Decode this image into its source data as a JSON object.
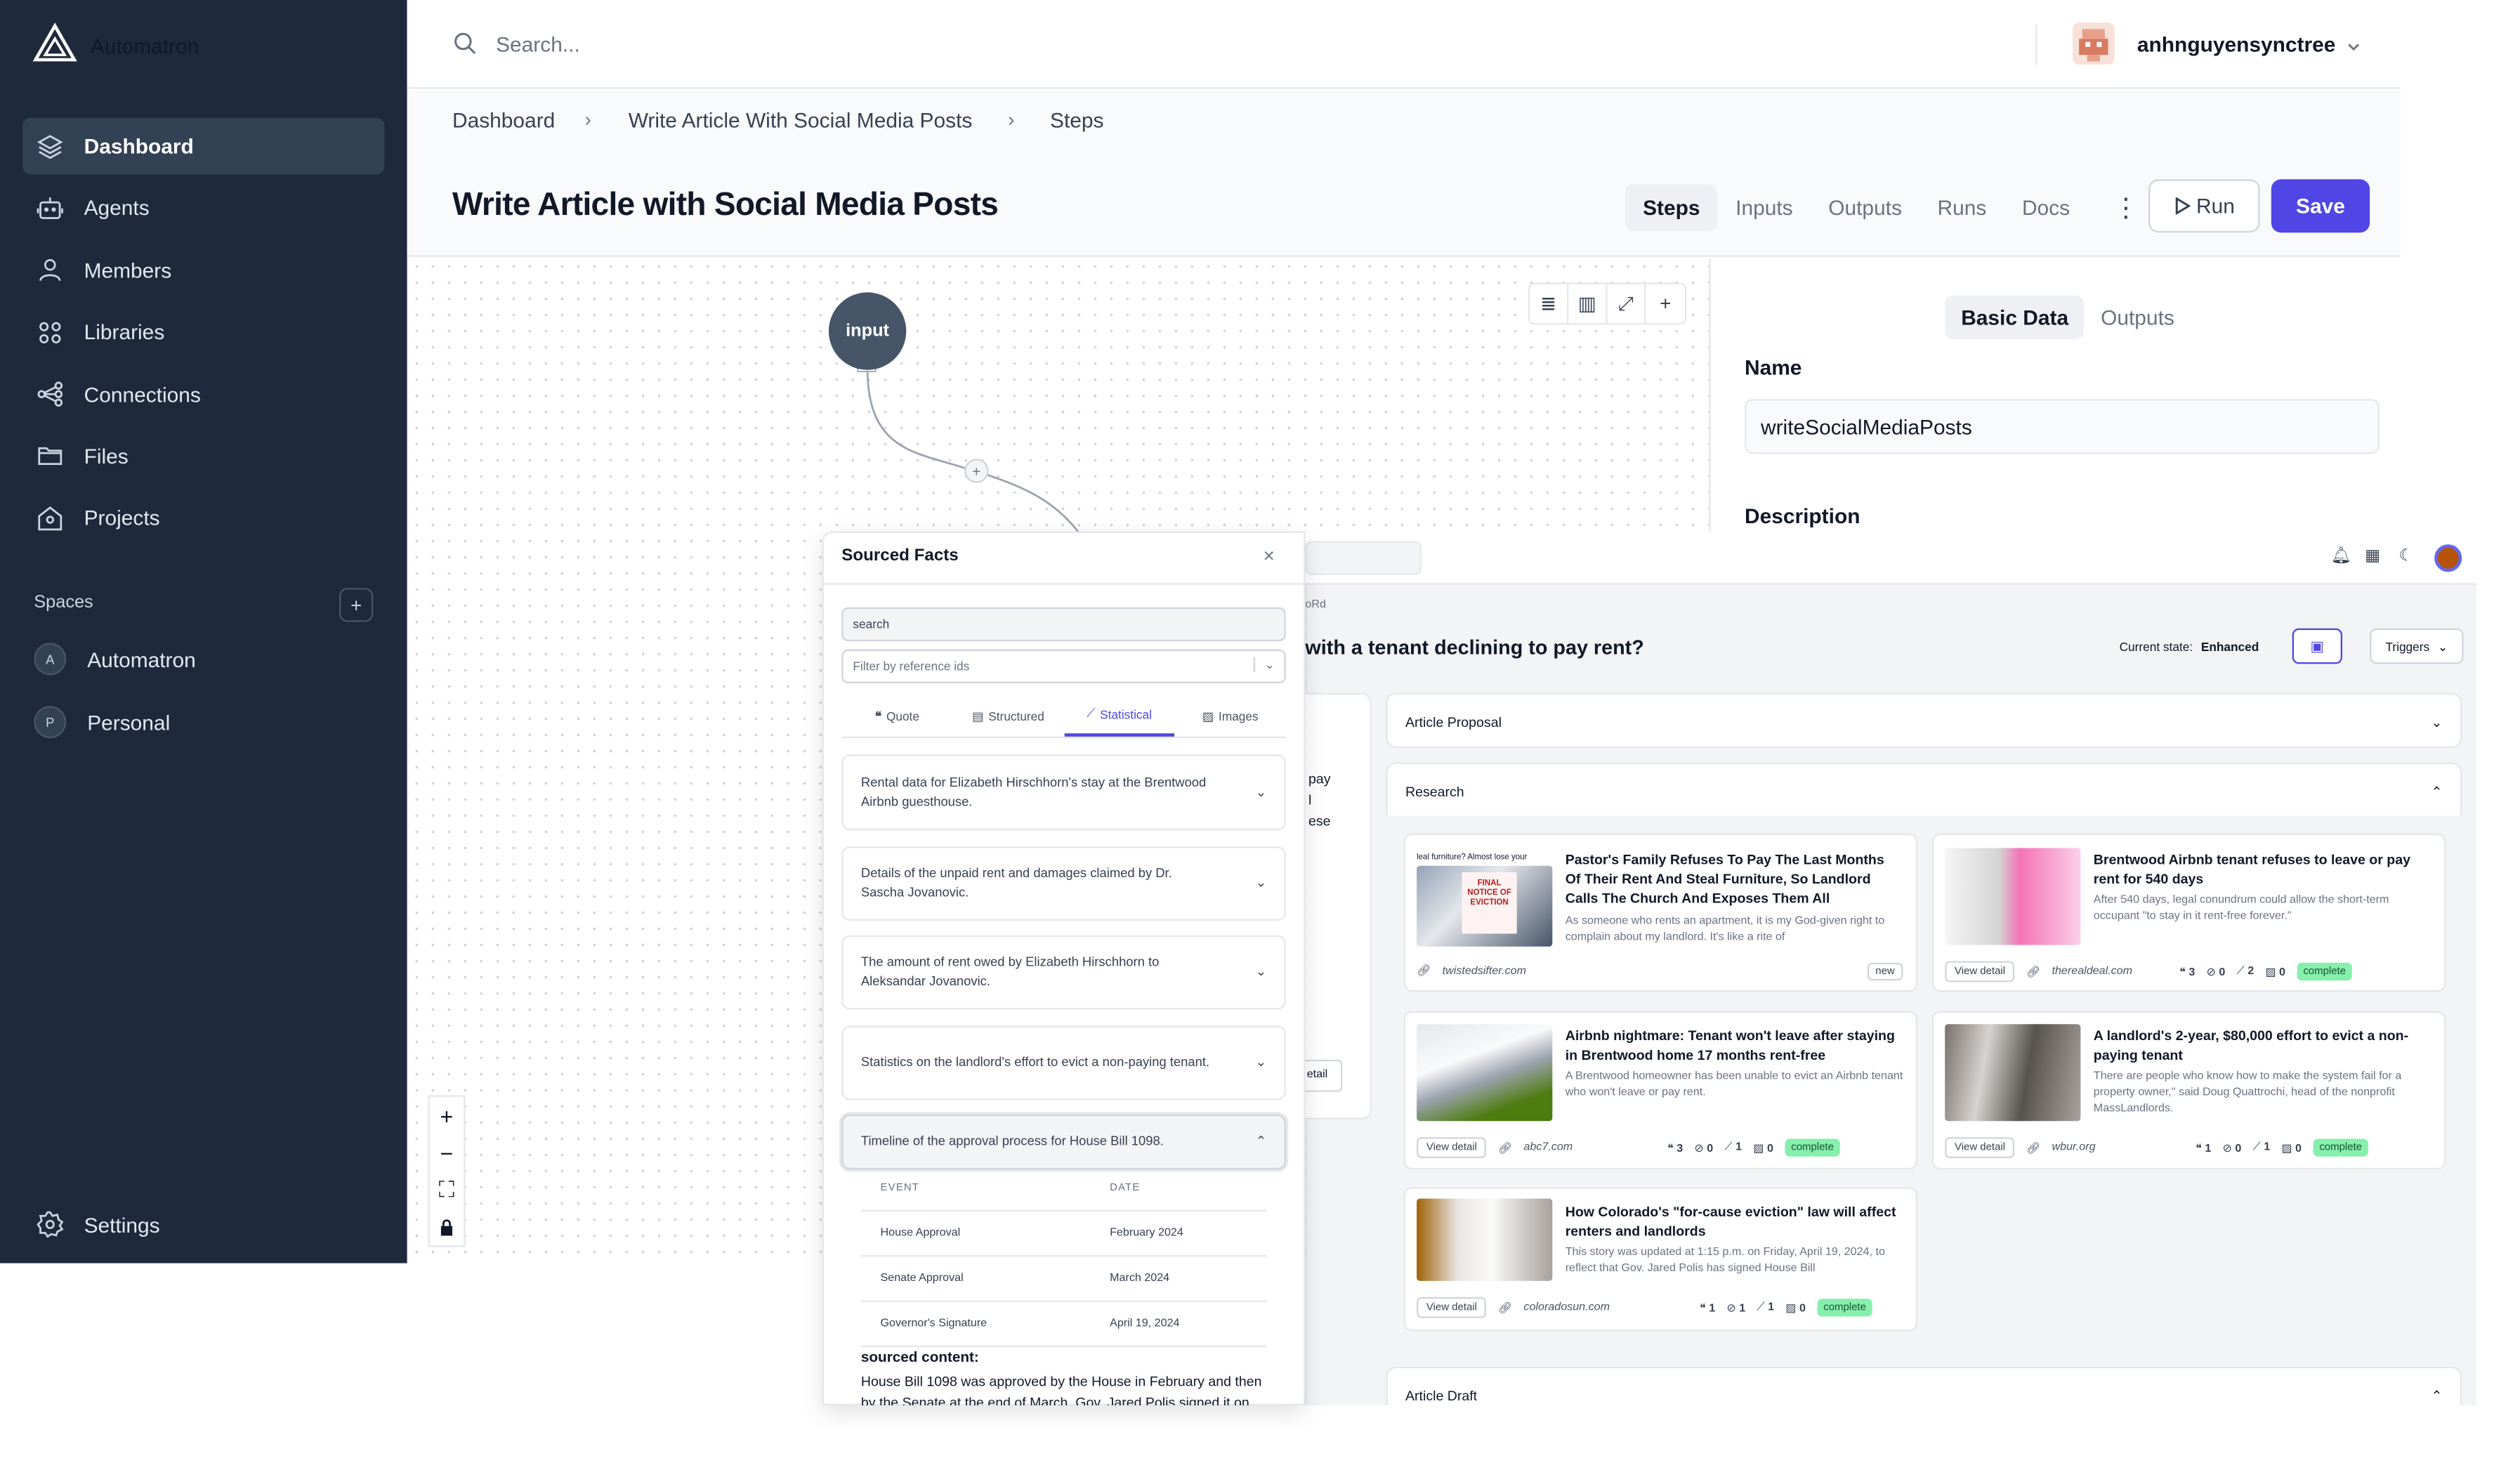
{
  "app": {
    "name": "Automatron"
  },
  "sidebar": {
    "items": [
      {
        "label": "Dashboard",
        "icon": "layers-icon",
        "active": true
      },
      {
        "label": "Agents",
        "icon": "robot-icon"
      },
      {
        "label": "Members",
        "icon": "user-icon"
      },
      {
        "label": "Libraries",
        "icon": "grid-icon"
      },
      {
        "label": "Connections",
        "icon": "share-icon"
      },
      {
        "label": "Files",
        "icon": "folder-icon"
      },
      {
        "label": "Projects",
        "icon": "home-icon"
      }
    ],
    "spaces_title": "Spaces",
    "spaces_add": "+",
    "spaces": [
      {
        "initial": "A",
        "label": "Automatron"
      },
      {
        "initial": "P",
        "label": "Personal"
      }
    ],
    "settings": "Settings"
  },
  "header": {
    "search_placeholder": "Search...",
    "username": "anhnguyensynctree"
  },
  "breadcrumb": [
    "Dashboard",
    "Write Article With Social Media Posts",
    "Steps"
  ],
  "page": {
    "title": "Write Article with Social Media Posts",
    "tabs": [
      "Steps",
      "Inputs",
      "Outputs",
      "Runs",
      "Docs"
    ],
    "active_tab": "Steps",
    "run_label": "Run",
    "save_label": "Save"
  },
  "canvas": {
    "input_node": "input",
    "edge_add": "+"
  },
  "right_panel": {
    "tabs": [
      "Basic Data",
      "Outputs"
    ],
    "name_label": "Name",
    "name_value": "writeSocialMediaPosts",
    "description_label": "Description"
  },
  "overlay_app": {
    "crumb": "oRd",
    "title_fragment": "with a tenant declining to pay rent?",
    "current_state_label": "Current state:",
    "current_state_value": "Enhanced",
    "triggers": "Triggers",
    "left_fragments": [
      "pay",
      "l",
      "ese",
      "etail"
    ],
    "sections": {
      "proposal": "Article Proposal",
      "research": "Research",
      "draft": "Article Draft"
    },
    "research_cards": [
      {
        "title": "Pastor's Family Refuses To Pay The Last Months Of Their Rent And Steal Furniture, So Landlord Calls The Church And Exposes Them All",
        "summary": "As someone who rents an apartment, it is my God-given right to complain about my landlord. It's like a rite of",
        "source": "twistedsifter.com",
        "badge": "new",
        "img_caption": "leal furniture? Almost lose your",
        "img_text": "FINAL NOTICE OF EVICTION"
      },
      {
        "title": "Brentwood Airbnb tenant refuses to leave or pay rent for 540 days",
        "summary": "After 540 days, legal conundrum could allow the short-term occupant \"to stay in it rent-free forever.\"",
        "source": "therealdeal.com",
        "view": "View detail",
        "stats": [
          "3",
          "0",
          "2",
          "0"
        ],
        "badge": "complete"
      },
      {
        "title": "Airbnb nightmare: Tenant won't leave after staying in Brentwood home 17 months rent-free",
        "summary": "A Brentwood homeowner has been unable to evict an Airbnb tenant who won't leave or pay rent.",
        "source": "abc7.com",
        "view": "View detail",
        "stats": [
          "3",
          "0",
          "1",
          "0"
        ],
        "badge": "complete"
      },
      {
        "title": "A landlord's 2-year, $80,000 effort to evict a non-paying tenant",
        "summary": "There are people who know how to make the system fail for a property owner,\" said Doug Quattrochi, head of the nonprofit MassLandlords.",
        "source": "wbur.org",
        "view": "View detail",
        "stats": [
          "1",
          "0",
          "1",
          "0"
        ],
        "badge": "complete"
      },
      {
        "title": "How Colorado's \"for-cause eviction\" law will affect renters and landlords",
        "summary": "This story was updated at 1:15 p.m. on Friday, April 19, 2024, to reflect that Gov. Jared Polis has signed House Bill",
        "source": "coloradosun.com",
        "view": "View detail",
        "stats": [
          "1",
          "1",
          "1",
          "0"
        ],
        "badge": "complete"
      }
    ]
  },
  "sourced_facts": {
    "title": "Sourced Facts",
    "close": "×",
    "search_placeholder": "search",
    "filter_placeholder": "Filter by reference ids",
    "tabs": [
      "Quote",
      "Structured",
      "Statistical",
      "Images"
    ],
    "active_tab": "Statistical",
    "facts": [
      "Rental data for Elizabeth Hirschhorn's stay at the Brentwood Airbnb guesthouse.",
      "Details of the unpaid rent and damages claimed by Dr. Sascha Jovanovic.",
      "The amount of rent owed by Elizabeth Hirschhorn to Aleksandar Jovanovic.",
      "Statistics on the landlord's effort to evict a non-paying tenant.",
      "Timeline of the approval process for House Bill 1098."
    ],
    "timeline": {
      "headers": [
        "EVENT",
        "DATE"
      ],
      "rows": [
        {
          "event": "House Approval",
          "date": "February 2024"
        },
        {
          "event": "Senate Approval",
          "date": "March 2024"
        },
        {
          "event": "Governor's Signature",
          "date": "April 19, 2024"
        }
      ]
    },
    "sourced_content_label": "sourced content:",
    "sourced_content": "House Bill 1098 was approved by the House in February and then by the Senate at the end of March. Gov. Jared Polis signed it on"
  },
  "colors": {
    "sidebar_bg": "#1e293b",
    "accent": "#4f46e5",
    "complete_badge": "#86efac"
  }
}
